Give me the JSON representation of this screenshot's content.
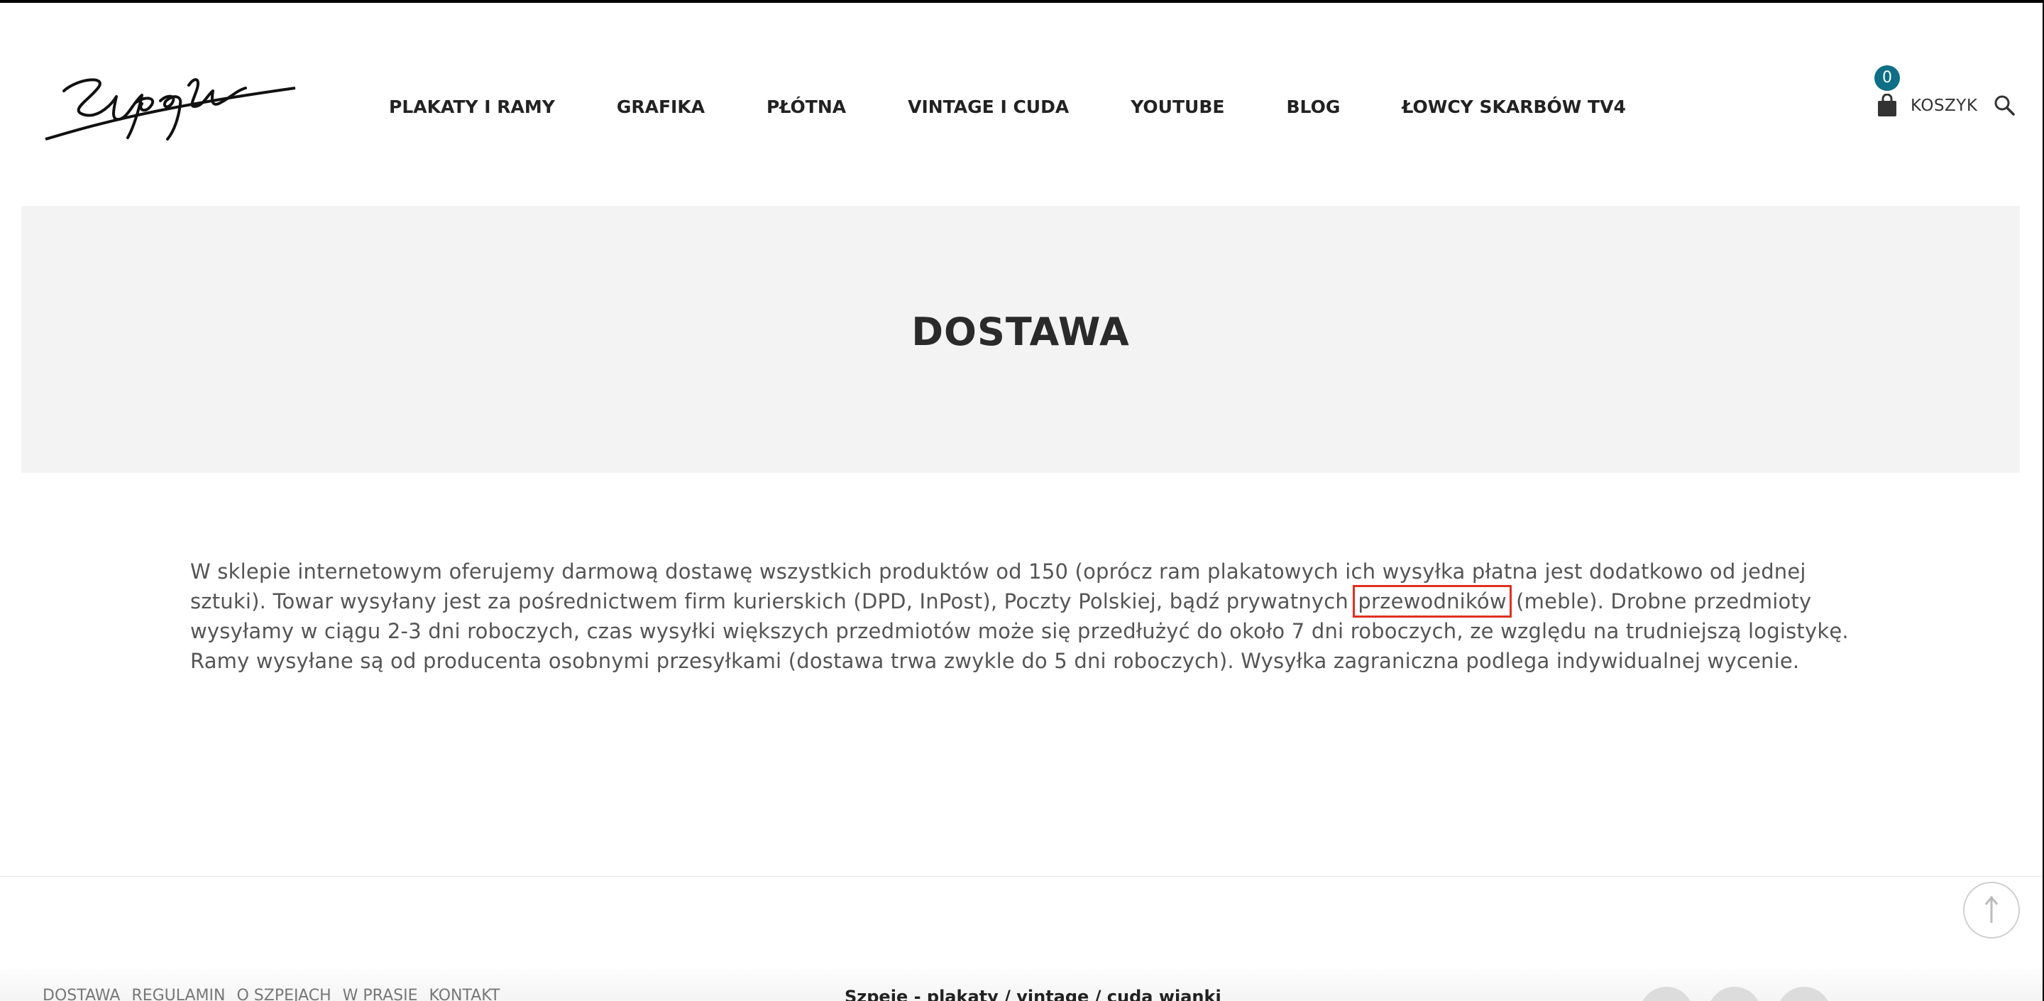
{
  "brand": {
    "logo_text": "Szpejer"
  },
  "nav": {
    "items": [
      {
        "label": "PLAKATY I RAMY"
      },
      {
        "label": "GRAFIKA"
      },
      {
        "label": "PŁÓTNA"
      },
      {
        "label": "VINTAGE I CUDA"
      },
      {
        "label": "YOUTUBE"
      },
      {
        "label": "BLOG"
      },
      {
        "label": "ŁOWCY SKARBÓW TV4"
      }
    ]
  },
  "cart": {
    "count": "0",
    "label": "KOSZYK",
    "icon": "shopping-bag-icon",
    "badge_color": "#0e6f86"
  },
  "search": {
    "icon": "search-icon"
  },
  "banner": {
    "title": "DOSTAWA"
  },
  "content": {
    "part1": "W sklepie internetowym oferujemy darmową dostawę wszystkich produktów od 150 (oprócz ram plakatowych ich wysyłka płatna jest dodatkowo od jednej sztuki). Towar wysyłany jest za pośrednictwem firm kurierskich (DPD, InPost), Poczty Polskiej, bądź prywatnych ",
    "highlighted": "przewodników",
    "part2": " (meble). Drobne przedmioty wysyłamy w ciągu 2-3 dni roboczych, czas wysyłki większych przedmiotów może się przedłużyć do około 7 dni roboczych, ze względu na trudniejszą logistykę. Ramy wysyłane są od producenta osobnymi przesyłkami (dostawa trwa zwykle do 5 dni roboczych). Wysyłka zagraniczna podlega indywidualnej wycenie.",
    "highlight_color": "#e0301e"
  },
  "footer": {
    "links": [
      {
        "label": "DOSTAWA"
      },
      {
        "label": "REGULAMIN"
      },
      {
        "label": "O SZPEJACH"
      },
      {
        "label": "W PRASIE"
      },
      {
        "label": "KONTAKT"
      }
    ],
    "tagline": "Szpeje - plakaty / vintage / cuda wianki",
    "scroll_top_icon": "arrow-up-icon"
  }
}
